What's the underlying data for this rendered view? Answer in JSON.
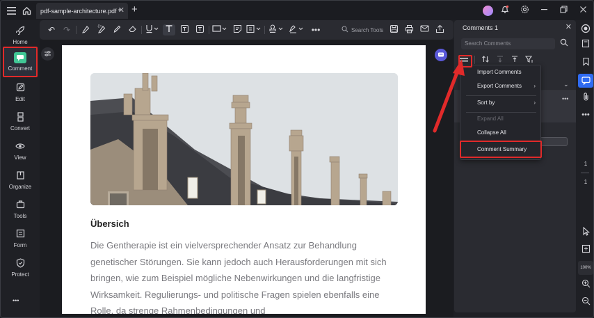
{
  "titlebar": {
    "tab_title": "pdf-sample-architecture.pdf *",
    "tab_close": "✕",
    "new_tab": "+"
  },
  "left_nav": {
    "items": [
      {
        "label": "Home",
        "icon": "rocket-icon"
      },
      {
        "label": "Comment",
        "icon": "comment-icon"
      },
      {
        "label": "Edit",
        "icon": "edit-icon"
      },
      {
        "label": "Convert",
        "icon": "convert-icon"
      },
      {
        "label": "View",
        "icon": "eye-icon"
      },
      {
        "label": "Organize",
        "icon": "organize-icon"
      },
      {
        "label": "Tools",
        "icon": "toolbox-icon"
      },
      {
        "label": "Form",
        "icon": "form-icon"
      },
      {
        "label": "Protect",
        "icon": "shield-icon"
      }
    ],
    "more": "•••"
  },
  "toolbar": {
    "search_placeholder": "Search Tools"
  },
  "document": {
    "heading": "Übersich",
    "paragraph": "Die Gentherapie ist ein vielversprechender Ansatz zur Behandlung genetischer Störungen. Sie kann jedoch auch Herausforderungen mit sich bringen, wie zum Beispiel mögliche Nebenwirkungen und die langfristige Wirksamkeit. Regulierungs- und politische Fragen spielen ebenfalls eine Rolle, da strenge Rahmenbedingungen und"
  },
  "comments_panel": {
    "title": "Comments 1",
    "close": "✕",
    "search_placeholder": "Search Comments",
    "more": "•••",
    "chevron": "⌄"
  },
  "menu": {
    "items": [
      {
        "label": "Import Comments",
        "enabled": true,
        "submenu": false
      },
      {
        "label": "Export Comments",
        "enabled": true,
        "submenu": true
      },
      {
        "label": "Sort by",
        "enabled": true,
        "submenu": true
      },
      {
        "label": "Expand All",
        "enabled": false,
        "submenu": false
      },
      {
        "label": "Collapse All",
        "enabled": true,
        "submenu": false
      },
      {
        "label": "Comment Summary",
        "enabled": true,
        "submenu": false
      }
    ],
    "submenu_arrow": "›"
  },
  "right_rail": {
    "page_current": "1",
    "page_total": "1",
    "zoom": "100%"
  },
  "colors": {
    "highlight": "#e12a2a",
    "accent_blue": "#2f6bf2",
    "comment_green": "#41c796"
  }
}
